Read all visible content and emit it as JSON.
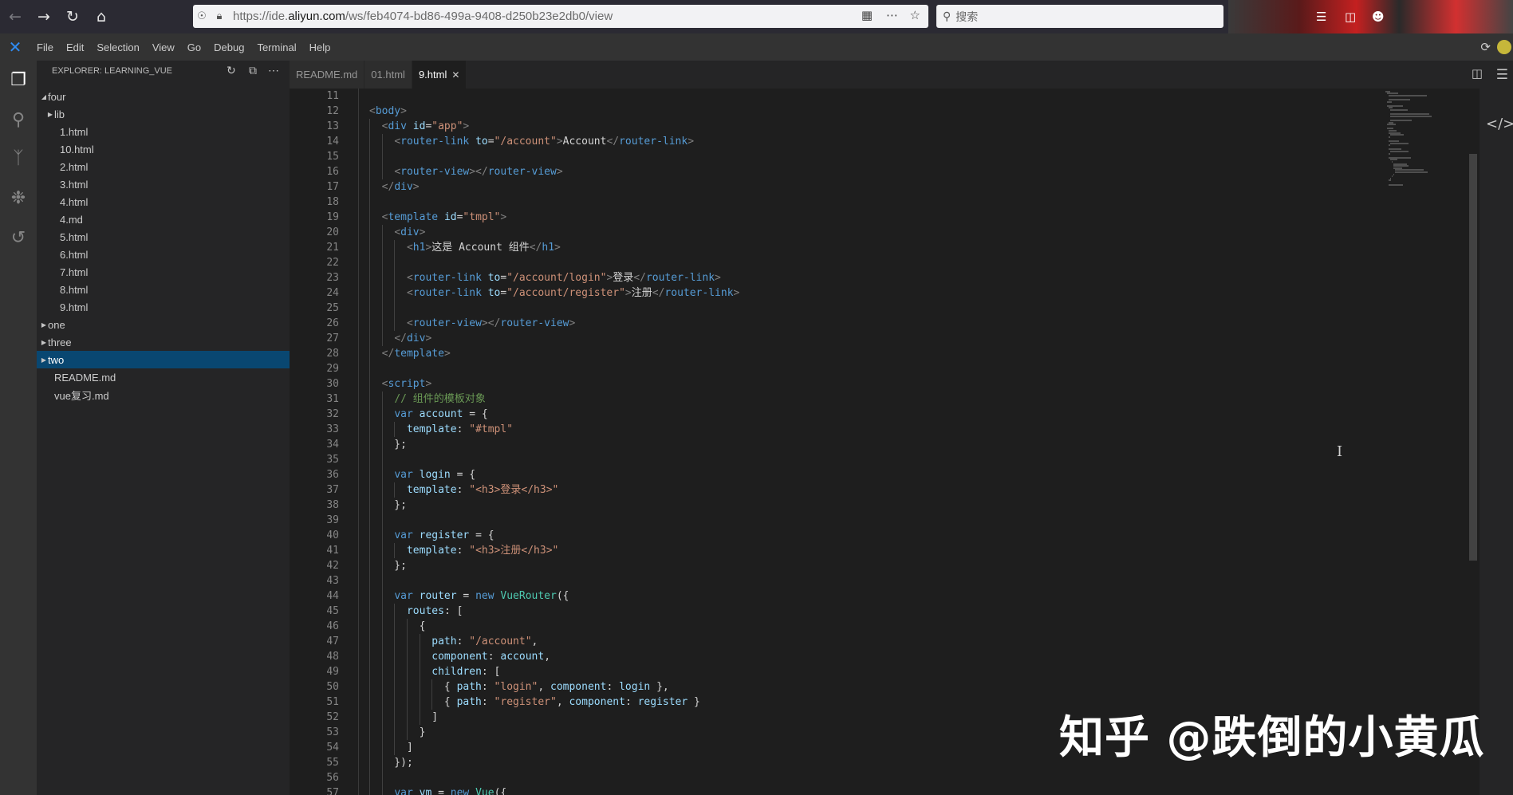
{
  "browser": {
    "url_prefix": "https://ide.",
    "url_domain": "aliyun.com",
    "url_rest": "/ws/feb4074-bd86-499a-9408-d250b23e2db0/view",
    "search_placeholder": "搜索"
  },
  "menu": {
    "items": [
      "File",
      "Edit",
      "Selection",
      "View",
      "Go",
      "Debug",
      "Terminal",
      "Help"
    ]
  },
  "sidebar": {
    "title": "EXPLORER: LEARNING_VUE",
    "tree": [
      {
        "label": "four",
        "level": 0,
        "folder": true,
        "expanded": true
      },
      {
        "label": "lib",
        "level": 1,
        "folder": true,
        "expanded": false
      },
      {
        "label": "1.html",
        "level": 2
      },
      {
        "label": "10.html",
        "level": 2
      },
      {
        "label": "2.html",
        "level": 2
      },
      {
        "label": "3.html",
        "level": 2
      },
      {
        "label": "4.html",
        "level": 2
      },
      {
        "label": "4.md",
        "level": 2
      },
      {
        "label": "5.html",
        "level": 2
      },
      {
        "label": "6.html",
        "level": 2
      },
      {
        "label": "7.html",
        "level": 2
      },
      {
        "label": "8.html",
        "level": 2
      },
      {
        "label": "9.html",
        "level": 2
      },
      {
        "label": "one",
        "level": 0,
        "folder": true,
        "expanded": false
      },
      {
        "label": "three",
        "level": 0,
        "folder": true,
        "expanded": false
      },
      {
        "label": "two",
        "level": 0,
        "folder": true,
        "expanded": false,
        "selected": true
      },
      {
        "label": "README.md",
        "level": 1
      },
      {
        "label": "vue复习.md",
        "level": 1
      }
    ]
  },
  "tabs": [
    {
      "label": "README.md",
      "active": false
    },
    {
      "label": "01.html",
      "active": false
    },
    {
      "label": "9.html",
      "active": true,
      "close": "✕"
    }
  ],
  "editor": {
    "first_line": 11,
    "lines": [
      [],
      [
        [
          "br",
          "<"
        ],
        [
          "tag",
          "body"
        ],
        [
          "br",
          ">"
        ]
      ],
      [
        [
          "pl",
          "  "
        ],
        [
          "br",
          "<"
        ],
        [
          "tag",
          "div"
        ],
        [
          "pl",
          " "
        ],
        [
          "attr",
          "id"
        ],
        [
          "pl",
          "="
        ],
        [
          "str",
          "\"app\""
        ],
        [
          "br",
          ">"
        ]
      ],
      [
        [
          "pl",
          "    "
        ],
        [
          "br",
          "<"
        ],
        [
          "tag",
          "router-link"
        ],
        [
          "pl",
          " "
        ],
        [
          "attr",
          "to"
        ],
        [
          "pl",
          "="
        ],
        [
          "str",
          "\"/account\""
        ],
        [
          "br",
          ">"
        ],
        [
          "pl",
          "Account"
        ],
        [
          "br",
          "</"
        ],
        [
          "tag",
          "router-link"
        ],
        [
          "br",
          ">"
        ]
      ],
      [],
      [
        [
          "pl",
          "    "
        ],
        [
          "br",
          "<"
        ],
        [
          "tag",
          "router-view"
        ],
        [
          "br",
          "></"
        ],
        [
          "tag",
          "router-view"
        ],
        [
          "br",
          ">"
        ]
      ],
      [
        [
          "pl",
          "  "
        ],
        [
          "br",
          "</"
        ],
        [
          "tag",
          "div"
        ],
        [
          "br",
          ">"
        ]
      ],
      [],
      [
        [
          "pl",
          "  "
        ],
        [
          "br",
          "<"
        ],
        [
          "tag",
          "template"
        ],
        [
          "pl",
          " "
        ],
        [
          "attr",
          "id"
        ],
        [
          "pl",
          "="
        ],
        [
          "str",
          "\"tmpl\""
        ],
        [
          "br",
          ">"
        ]
      ],
      [
        [
          "pl",
          "    "
        ],
        [
          "br",
          "<"
        ],
        [
          "tag",
          "div"
        ],
        [
          "br",
          ">"
        ]
      ],
      [
        [
          "pl",
          "      "
        ],
        [
          "br",
          "<"
        ],
        [
          "tag",
          "h1"
        ],
        [
          "br",
          ">"
        ],
        [
          "pl",
          "这是 Account 组件"
        ],
        [
          "br",
          "</"
        ],
        [
          "tag",
          "h1"
        ],
        [
          "br",
          ">"
        ]
      ],
      [],
      [
        [
          "pl",
          "      "
        ],
        [
          "br",
          "<"
        ],
        [
          "tag",
          "router-link"
        ],
        [
          "pl",
          " "
        ],
        [
          "attr",
          "to"
        ],
        [
          "pl",
          "="
        ],
        [
          "str",
          "\"/account/login\""
        ],
        [
          "br",
          ">"
        ],
        [
          "pl",
          "登录"
        ],
        [
          "br",
          "</"
        ],
        [
          "tag",
          "router-link"
        ],
        [
          "br",
          ">"
        ]
      ],
      [
        [
          "pl",
          "      "
        ],
        [
          "br",
          "<"
        ],
        [
          "tag",
          "router-link"
        ],
        [
          "pl",
          " "
        ],
        [
          "attr",
          "to"
        ],
        [
          "pl",
          "="
        ],
        [
          "str",
          "\"/account/register\""
        ],
        [
          "br",
          ">"
        ],
        [
          "pl",
          "注册"
        ],
        [
          "br",
          "</"
        ],
        [
          "tag",
          "router-link"
        ],
        [
          "br",
          ">"
        ]
      ],
      [],
      [
        [
          "pl",
          "      "
        ],
        [
          "br",
          "<"
        ],
        [
          "tag",
          "router-view"
        ],
        [
          "br",
          "></"
        ],
        [
          "tag",
          "router-view"
        ],
        [
          "br",
          ">"
        ]
      ],
      [
        [
          "pl",
          "    "
        ],
        [
          "br",
          "</"
        ],
        [
          "tag",
          "div"
        ],
        [
          "br",
          ">"
        ]
      ],
      [
        [
          "pl",
          "  "
        ],
        [
          "br",
          "</"
        ],
        [
          "tag",
          "template"
        ],
        [
          "br",
          ">"
        ]
      ],
      [],
      [
        [
          "pl",
          "  "
        ],
        [
          "br",
          "<"
        ],
        [
          "tag",
          "script"
        ],
        [
          "br",
          ">"
        ]
      ],
      [
        [
          "pl",
          "    "
        ],
        [
          "com",
          "// 组件的模板对象"
        ]
      ],
      [
        [
          "pl",
          "    "
        ],
        [
          "kw",
          "var"
        ],
        [
          "pl",
          " "
        ],
        [
          "prop",
          "account"
        ],
        [
          "pl",
          " = {"
        ]
      ],
      [
        [
          "pl",
          "      "
        ],
        [
          "prop",
          "template"
        ],
        [
          "pl",
          ": "
        ],
        [
          "str",
          "\"#tmpl\""
        ]
      ],
      [
        [
          "pl",
          "    };"
        ]
      ],
      [],
      [
        [
          "pl",
          "    "
        ],
        [
          "kw",
          "var"
        ],
        [
          "pl",
          " "
        ],
        [
          "prop",
          "login"
        ],
        [
          "pl",
          " = {"
        ]
      ],
      [
        [
          "pl",
          "      "
        ],
        [
          "prop",
          "template"
        ],
        [
          "pl",
          ": "
        ],
        [
          "str",
          "\"<h3>登录</h3>\""
        ]
      ],
      [
        [
          "pl",
          "    };"
        ]
      ],
      [],
      [
        [
          "pl",
          "    "
        ],
        [
          "kw",
          "var"
        ],
        [
          "pl",
          " "
        ],
        [
          "prop",
          "register"
        ],
        [
          "pl",
          " = {"
        ]
      ],
      [
        [
          "pl",
          "      "
        ],
        [
          "prop",
          "template"
        ],
        [
          "pl",
          ": "
        ],
        [
          "str",
          "\"<h3>注册</h3>\""
        ]
      ],
      [
        [
          "pl",
          "    };"
        ]
      ],
      [],
      [
        [
          "pl",
          "    "
        ],
        [
          "kw",
          "var"
        ],
        [
          "pl",
          " "
        ],
        [
          "prop",
          "router"
        ],
        [
          "pl",
          " = "
        ],
        [
          "kw",
          "new"
        ],
        [
          "pl",
          " "
        ],
        [
          "cls",
          "VueRouter"
        ],
        [
          "pl",
          "({"
        ]
      ],
      [
        [
          "pl",
          "      "
        ],
        [
          "prop",
          "routes"
        ],
        [
          "pl",
          ": ["
        ]
      ],
      [
        [
          "pl",
          "        {"
        ]
      ],
      [
        [
          "pl",
          "          "
        ],
        [
          "prop",
          "path"
        ],
        [
          "pl",
          ": "
        ],
        [
          "str",
          "\"/account\""
        ],
        [
          "pl",
          ","
        ]
      ],
      [
        [
          "pl",
          "          "
        ],
        [
          "prop",
          "component"
        ],
        [
          "pl",
          ": "
        ],
        [
          "prop",
          "account"
        ],
        [
          "pl",
          ","
        ]
      ],
      [
        [
          "pl",
          "          "
        ],
        [
          "prop",
          "children"
        ],
        [
          "pl",
          ": ["
        ]
      ],
      [
        [
          "pl",
          "            { "
        ],
        [
          "prop",
          "path"
        ],
        [
          "pl",
          ": "
        ],
        [
          "str",
          "\"login\""
        ],
        [
          "pl",
          ", "
        ],
        [
          "prop",
          "component"
        ],
        [
          "pl",
          ": "
        ],
        [
          "prop",
          "login"
        ],
        [
          "pl",
          " },"
        ]
      ],
      [
        [
          "pl",
          "            { "
        ],
        [
          "prop",
          "path"
        ],
        [
          "pl",
          ": "
        ],
        [
          "str",
          "\"register\""
        ],
        [
          "pl",
          ", "
        ],
        [
          "prop",
          "component"
        ],
        [
          "pl",
          ": "
        ],
        [
          "prop",
          "register"
        ],
        [
          "pl",
          " }"
        ]
      ],
      [
        [
          "pl",
          "          ]"
        ]
      ],
      [
        [
          "pl",
          "        }"
        ]
      ],
      [
        [
          "pl",
          "      ]"
        ]
      ],
      [
        [
          "pl",
          "    });"
        ]
      ],
      [],
      [
        [
          "pl",
          "    "
        ],
        [
          "kw",
          "var"
        ],
        [
          "pl",
          " "
        ],
        [
          "prop",
          "vm"
        ],
        [
          "pl",
          " = "
        ],
        [
          "kw",
          "new"
        ],
        [
          "pl",
          " "
        ],
        [
          "cls",
          "Vue"
        ],
        [
          "pl",
          "({"
        ]
      ]
    ]
  },
  "watermark": "知乎 @跌倒的小黄瓜",
  "icons": {
    "back": "arrow-left-icon",
    "forward": "arrow-right-icon",
    "reload": "reload-icon",
    "home": "home-icon",
    "explorer": "files-icon",
    "search": "search-icon",
    "scm": "source-control-icon",
    "debug": "debug-icon",
    "history": "history-icon"
  }
}
